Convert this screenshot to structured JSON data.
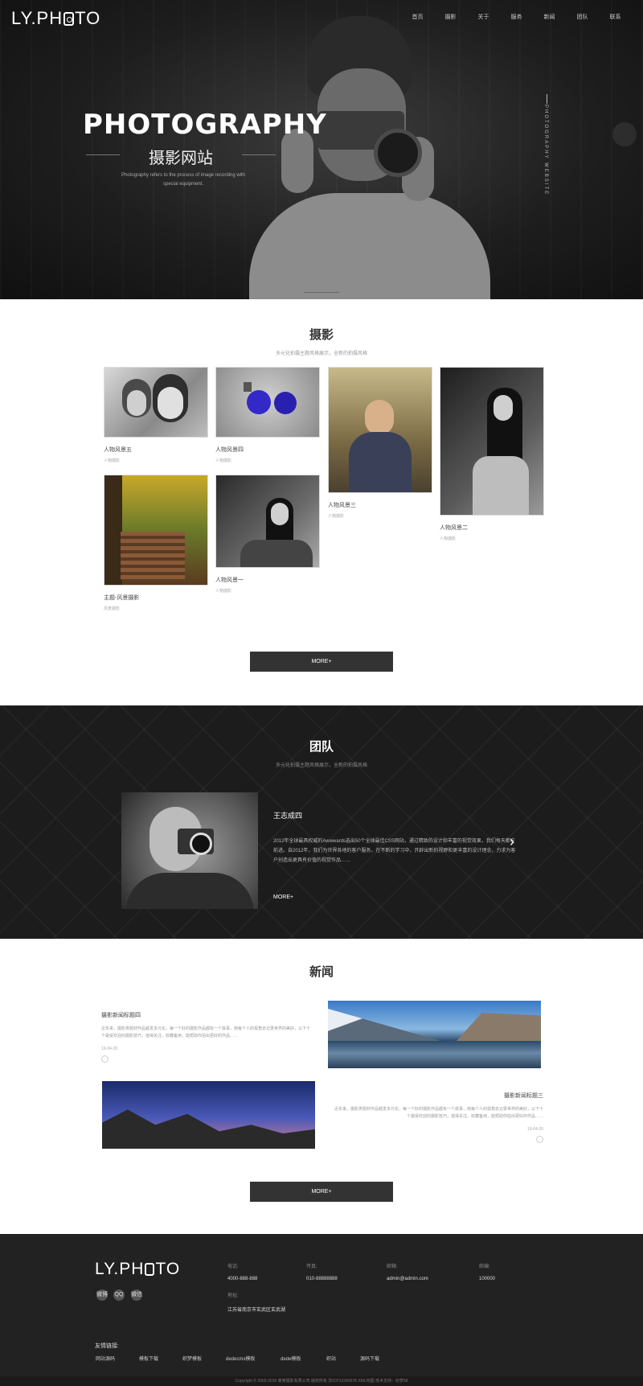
{
  "header": {
    "logo_left": "LY.PH",
    "logo_right": "TO",
    "nav": [
      "首页",
      "摄影",
      "关于",
      "服务",
      "新闻",
      "团队",
      "联系"
    ]
  },
  "hero": {
    "title": "PHOTOGRAPHY",
    "subtitle": "摄影网站",
    "desc": "Photography refers to the process of image recording with special equipment.",
    "vertical_text": "PHOTOGRAPHY WEBSITE"
  },
  "photo": {
    "title": "摄影",
    "subtitle": "多元化拍摄主题风格展示，全新的拍摄风格",
    "items": [
      {
        "name": "人物风景五",
        "cat": "人物摄影"
      },
      {
        "name": "人物风景四",
        "cat": "人物摄影"
      },
      {
        "name": "人物风景三",
        "cat": "人物摄影"
      },
      {
        "name": "人物风景二",
        "cat": "人物摄影"
      },
      {
        "name": "主题-风景摄影",
        "cat": "风景摄影"
      },
      {
        "name": "人物风景一",
        "cat": "人物摄影"
      }
    ],
    "more": "MORE+"
  },
  "team": {
    "title": "团队",
    "subtitle": "多元化拍摄主题风格展示，全新的拍摄风格",
    "name": "王志成四",
    "desc": "2012年全球最具权威的Awwwards选出50个全球最佳CSS网站，通过精致的设计和丰富的视觉效果，我们每天都在前进。自2012年，我们为世界各地的客户服务，在不断的学习中，开辟出新的视野和更丰富的设计理念，力求为客户创造出更具有价值的视觉作品……",
    "more": "MORE+"
  },
  "news": {
    "title": "新闻",
    "items": [
      {
        "title": "摄影新闻标题四",
        "body": "近年来，摄影类题材作品越发多元化，每一个好的摄影作品都有一个故事，用每个人的视角去记录世界的美好，以下十个最受欢迎的摄影技巧，值得关注，收藏备用，能帮助你拍出更好的作品……",
        "date": "19-04-20"
      },
      {
        "title": "摄影新闻标题三",
        "body": "近年来，摄影类题材作品越发多元化，每一个好的摄影作品都有一个故事，用每个人的视角去记录世界的美好，以下十个最受欢迎的摄影技巧，值得关注，收藏备用，能帮助你拍出更好的作品……",
        "date": "19-04-20"
      }
    ],
    "more": "MORE+"
  },
  "footer": {
    "logo_left": "LY.PH",
    "logo_right": "TO",
    "social": [
      "微博",
      "QQ",
      "微信"
    ],
    "cols": [
      {
        "label": "电话:",
        "value": "4000-888-888"
      },
      {
        "label": "传真:",
        "value": "010-88888888"
      },
      {
        "label": "邮箱:",
        "value": "admin@admin.com"
      },
      {
        "label": "邮编:",
        "value": "100000"
      }
    ],
    "address_label": "地址:",
    "address": "江苏省南京市玄武区玄武湖",
    "links_title": "友情链接:",
    "links": [
      "网站源码",
      "模板下载",
      "织梦模板",
      "dedecms模板",
      "dede模板",
      "织站",
      "源码下载"
    ],
    "copyright": "Copyright © 2002-2019 某某摄影有限公司 版权所有  苏ICP12345678  XML地图  技术支持：织梦58"
  },
  "colors": {
    "dark": "#1c1c1c",
    "button": "#333333",
    "footer": "#222222"
  }
}
